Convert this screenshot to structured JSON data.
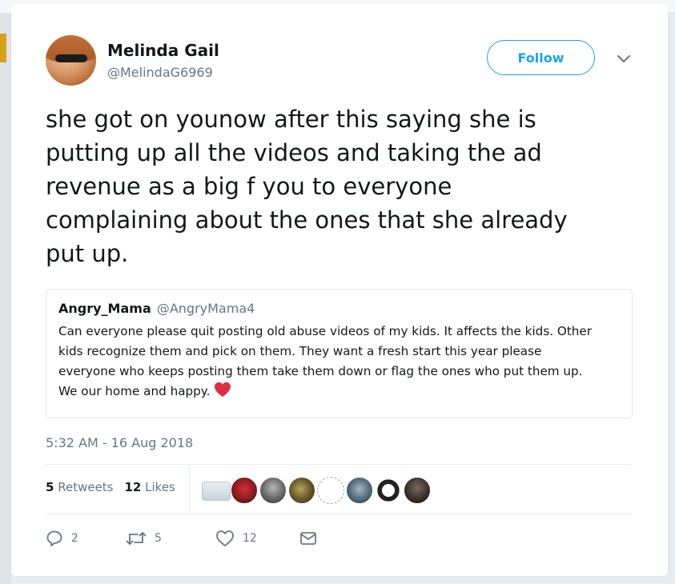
{
  "author": {
    "name": "Melinda Gail",
    "handle": "@MelindaG6969"
  },
  "header": {
    "follow_label": "Follow"
  },
  "tweet": {
    "lines": [
      "she got on younow after this saying she is",
      "putting up all the videos and taking the ad",
      "revenue as a big f you to everyone",
      "complaining about the ones that she already",
      "put up."
    ]
  },
  "quoted_tweet": {
    "name": "Angry_Mama",
    "handle": "@AngryMama4",
    "lines": [
      "Can everyone please quit posting old abuse videos of my kids. It affects the kids. Other",
      "kids recognize them and pick on them. They want a fresh start this year please",
      "everyone who keeps posting them take them down or flag the ones who put them up.",
      "We our home and happy."
    ],
    "emoji": "red-heart"
  },
  "timestamp": "5:32 AM - 16 Aug 2018",
  "stats": {
    "retweets_count": "5",
    "retweets_label": "Retweets",
    "likes_count": "12",
    "likes_label": "Likes"
  },
  "actions": {
    "reply_count": "2",
    "retweet_count": "5",
    "like_count": "12"
  },
  "colors": {
    "accent": "#1da1f2",
    "text": "#14171a",
    "secondary": "#657786",
    "heart": "#e0245e"
  }
}
